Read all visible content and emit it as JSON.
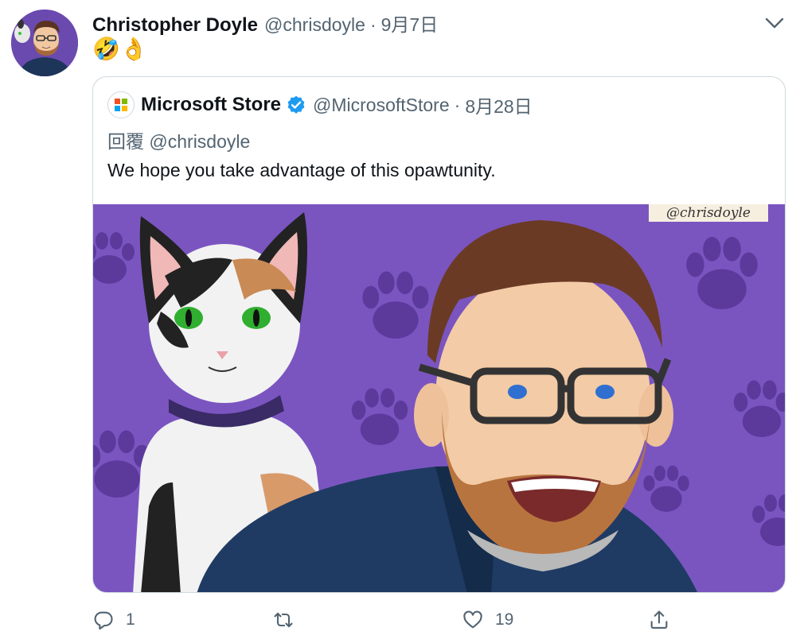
{
  "tweet": {
    "author_name": "Christopher Doyle",
    "author_handle": "@chrisdoyle",
    "separator": "·",
    "date": "9月7日",
    "text": "🤣👌"
  },
  "quote": {
    "author_name": "Microsoft Store",
    "author_handle": "@MicrosoftStore",
    "separator": "·",
    "date": "8月28日",
    "reply_label": "回覆",
    "reply_to": "@chrisdoyle",
    "text": "We hope you take advantage of this opawtunity.",
    "media_watermark": "@chrisdoyle",
    "media_description": "cartoon-cat-and-man-on-purple-pawprint-background"
  },
  "actions": {
    "reply_count": "1",
    "retweet_count": "",
    "like_count": "19"
  },
  "icons": {
    "more": "chevron-down-icon",
    "reply": "reply-icon",
    "retweet": "retweet-icon",
    "like": "heart-icon",
    "share": "share-icon",
    "verified": "verified-badge-icon"
  },
  "colors": {
    "text_primary": "#0f1419",
    "text_secondary": "#536471",
    "verified_blue": "#1d9bf0",
    "media_background": "#7a55c0",
    "ms_red": "#f25022",
    "ms_green": "#7fba00",
    "ms_blue": "#00a4ef",
    "ms_yellow": "#ffb900"
  }
}
